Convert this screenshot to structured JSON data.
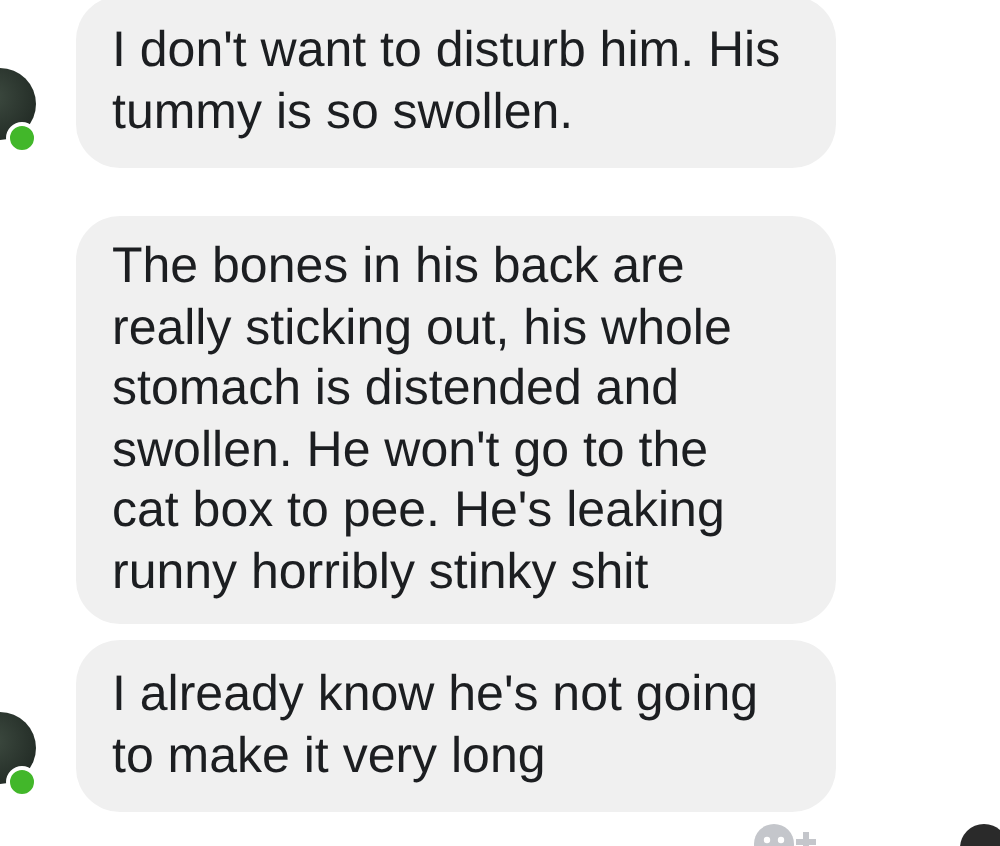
{
  "messages": [
    {
      "text": "I don't want to disturb him. His tummy is so swollen.",
      "show_avatar": true,
      "online": true
    },
    {
      "text": "The bones in his back are really sticking out, his whole stomach is distended and swollen. He won't go to the cat box to pee. He's leaking runny horribly stinky shit",
      "show_avatar": false,
      "online": false
    },
    {
      "text": "I already know he's not going to make it very long",
      "show_avatar": true,
      "online": true
    }
  ]
}
